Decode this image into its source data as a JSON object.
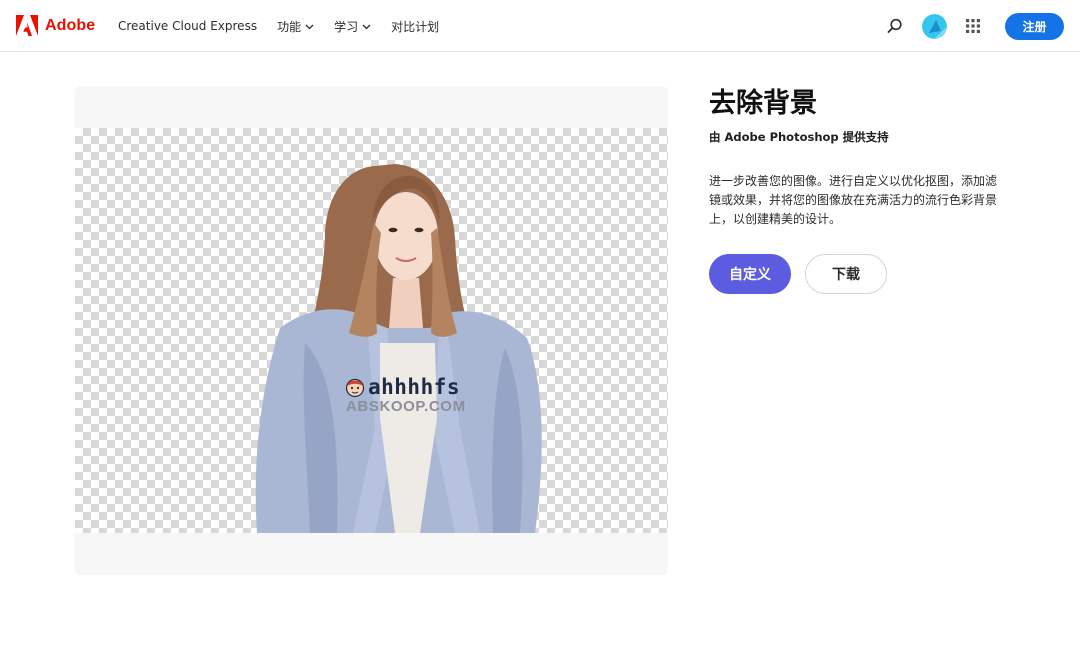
{
  "header": {
    "brand_name": "Adobe",
    "brand_logo_icon": "adobe-logo-icon",
    "brand_color": "#eb1000",
    "nav": [
      {
        "label": "Creative Cloud Express",
        "has_dropdown": false
      },
      {
        "label": "功能",
        "has_dropdown": true
      },
      {
        "label": "学习",
        "has_dropdown": true
      },
      {
        "label": "对比计划",
        "has_dropdown": false
      }
    ],
    "search_icon": "search-icon",
    "avatar_icon": "avatar-icon",
    "apps_icon": "app-grid-icon",
    "signup_label": "注册",
    "signup_color": "#1473e6"
  },
  "preview": {
    "watermark_text": "ahhhhfs",
    "watermark_domain": "ABSKOOP.COM",
    "transparency_pattern": "checkerboard"
  },
  "info": {
    "title": "去除背景",
    "subtitle": "由 Adobe Photoshop 提供支持",
    "description": "进一步改善您的图像。进行自定义以优化抠图，添加滤镜或效果，并将您的图像放在充满活力的流行色彩背景上，以创建精美的设计。",
    "customize_label": "自定义",
    "customize_color": "#5c5ce0",
    "download_label": "下载"
  }
}
